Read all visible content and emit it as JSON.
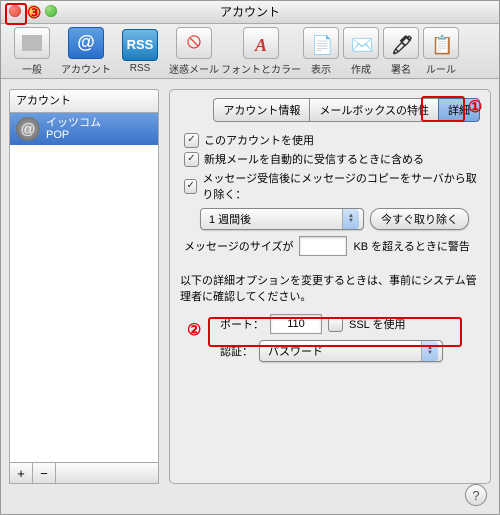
{
  "title": "アカウント",
  "toolbar": [
    {
      "label": "一般",
      "icon": "⬚"
    },
    {
      "label": "アカウント",
      "icon": "@"
    },
    {
      "label": "RSS",
      "icon": "RSS"
    },
    {
      "label": "迷惑メール",
      "icon": "✖"
    },
    {
      "label": "フォントとカラー",
      "icon": "A"
    },
    {
      "label": "表示",
      "icon": "☰"
    },
    {
      "label": "作成",
      "icon": "✎"
    },
    {
      "label": "署名",
      "icon": "✒"
    },
    {
      "label": "ルール",
      "icon": "▦"
    }
  ],
  "sidebar": {
    "header": "アカウント",
    "account": {
      "name": "イッツコム",
      "type": "POP"
    },
    "add": "+",
    "remove": "−"
  },
  "tabs": {
    "info": "アカウント情報",
    "mailbox": "メールボックスの特性",
    "advanced": "詳細"
  },
  "checks": {
    "use": "このアカウントを使用",
    "include": "新規メールを自動的に受信するときに含める",
    "removecopy": "メッセージ受信後にメッセージのコピーをサーバから取り除く："
  },
  "remove": {
    "after": "1 週間後",
    "now": "今すぐ取り除く"
  },
  "sizewarn": {
    "pre": "メッセージのサイズが",
    "suf": "KB を超えるときに警告"
  },
  "advnote": "以下の詳細オプションを変更するときは、事前にシステム管理者に確認してください。",
  "port": {
    "label": "ポート：",
    "value": "110",
    "ssl": "SSL を使用"
  },
  "auth": {
    "label": "認証：",
    "value": "パスワード"
  },
  "annotations": {
    "one": "①",
    "two": "②",
    "three": "③"
  },
  "help": "?"
}
